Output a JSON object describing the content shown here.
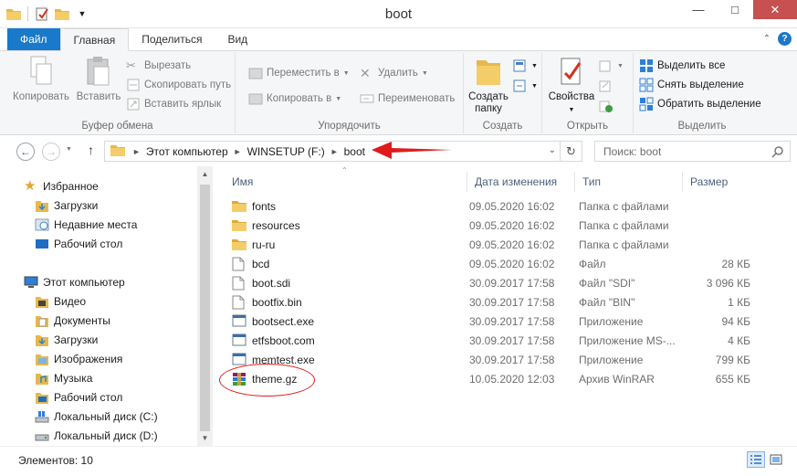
{
  "window": {
    "title": "boot"
  },
  "ribbon_tabs": [
    "Файл",
    "Главная",
    "Поделиться",
    "Вид"
  ],
  "ribbon": {
    "clipboard": {
      "label": "Буфер обмена",
      "copy": "Копировать",
      "paste": "Вставить",
      "cut": "Вырезать",
      "copy_path": "Скопировать путь",
      "paste_shortcut": "Вставить ярлык"
    },
    "organize": {
      "label": "Упорядочить",
      "move_to": "Переместить в",
      "copy_to": "Копировать в",
      "delete": "Удалить",
      "rename": "Переименовать"
    },
    "new": {
      "label": "Создать",
      "new_folder_line1": "Создать",
      "new_folder_line2": "папку"
    },
    "open": {
      "label": "Открыть",
      "properties": "Свойства"
    },
    "select": {
      "label": "Выделить",
      "select_all": "Выделить все",
      "select_none": "Снять выделение",
      "invert": "Обратить выделение"
    }
  },
  "address": {
    "crumbs": [
      "Этот компьютер",
      "WINSETUP (F:)",
      "boot"
    ],
    "search_placeholder": "Поиск: boot"
  },
  "nav": {
    "favorites": "Избранное",
    "favorites_items": [
      "Загрузки",
      "Недавние места",
      "Рабочий стол"
    ],
    "computer": "Этот компьютер",
    "computer_items": [
      "Видео",
      "Документы",
      "Загрузки",
      "Изображения",
      "Музыка",
      "Рабочий стол",
      "Локальный диск (C:)",
      "Локальный диск (D:)"
    ]
  },
  "columns": {
    "name": "Имя",
    "date": "Дата изменения",
    "type": "Тип",
    "size": "Размер"
  },
  "files": [
    {
      "name": "fonts",
      "date": "09.05.2020 16:02",
      "type": "Папка с файлами",
      "size": "",
      "icon": "folder-icon"
    },
    {
      "name": "resources",
      "date": "09.05.2020 16:02",
      "type": "Папка с файлами",
      "size": "",
      "icon": "folder-icon"
    },
    {
      "name": "ru-ru",
      "date": "09.05.2020 16:02",
      "type": "Папка с файлами",
      "size": "",
      "icon": "folder-icon"
    },
    {
      "name": "bcd",
      "date": "09.05.2020 16:02",
      "type": "Файл",
      "size": "28 КБ",
      "icon": "file-icon"
    },
    {
      "name": "boot.sdi",
      "date": "30.09.2017 17:58",
      "type": "Файл \"SDI\"",
      "size": "3 096 КБ",
      "icon": "file-icon"
    },
    {
      "name": "bootfix.bin",
      "date": "30.09.2017 17:58",
      "type": "Файл \"BIN\"",
      "size": "1 КБ",
      "icon": "file-icon"
    },
    {
      "name": "bootsect.exe",
      "date": "30.09.2017 17:58",
      "type": "Приложение",
      "size": "94 КБ",
      "icon": "exe-icon"
    },
    {
      "name": "etfsboot.com",
      "date": "30.09.2017 17:58",
      "type": "Приложение MS-...",
      "size": "4 КБ",
      "icon": "exe-icon"
    },
    {
      "name": "memtest.exe",
      "date": "30.09.2017 17:58",
      "type": "Приложение",
      "size": "799 КБ",
      "icon": "exe-icon"
    },
    {
      "name": "theme.gz",
      "date": "10.05.2020 12:03",
      "type": "Архив WinRAR",
      "size": "655 КБ",
      "icon": "winrar-icon"
    }
  ],
  "status": {
    "items": "Элементов: 10"
  },
  "colors": {
    "accent": "#1979ca",
    "annotation": "#e01b1b",
    "folder": "#e8b84a"
  }
}
